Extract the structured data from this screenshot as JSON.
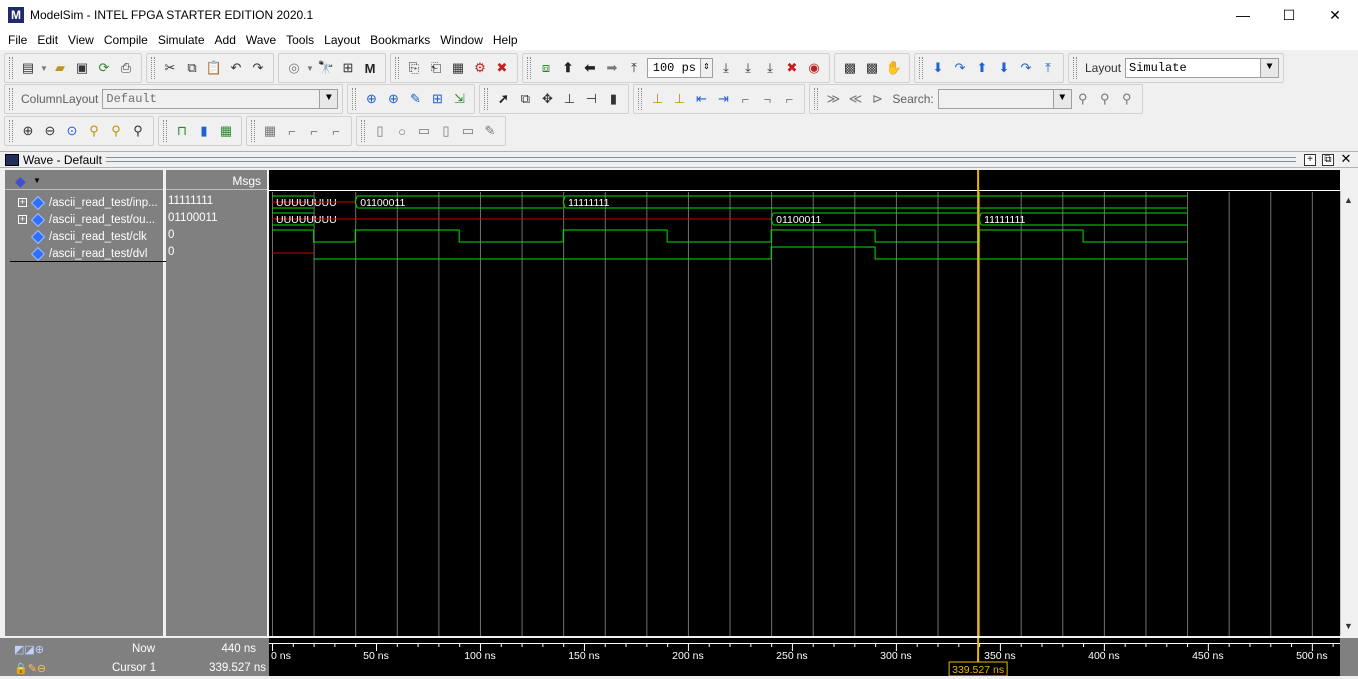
{
  "window": {
    "title": "ModelSim - INTEL FPGA STARTER EDITION 2020.1",
    "app_icon": "M",
    "controls": [
      "—",
      "☐",
      "✕"
    ]
  },
  "menu": [
    "File",
    "Edit",
    "View",
    "Compile",
    "Simulate",
    "Add",
    "Wave",
    "Tools",
    "Layout",
    "Bookmarks",
    "Window",
    "Help"
  ],
  "toolbar": {
    "run_length": "100 ps",
    "layout_label": "Layout",
    "layout_value": "Simulate",
    "column_layout_label": "ColumnLayout",
    "column_layout_value": "Default",
    "search_label": "Search:"
  },
  "wave_window": {
    "title": "Wave - Default",
    "msgs_header": "Msgs",
    "signals": [
      {
        "name": "/ascii_read_test/inp...",
        "value": "11111111",
        "expandable": true
      },
      {
        "name": "/ascii_read_test/ou...",
        "value": "01100011",
        "expandable": true
      },
      {
        "name": "/ascii_read_test/clk",
        "value": "0",
        "expandable": false
      },
      {
        "name": "/ascii_read_test/dvl",
        "value": "0",
        "expandable": false
      }
    ],
    "now_label": "Now",
    "now_value": "440 ns",
    "cursor_label": "Cursor 1",
    "cursor_value": "339.527 ns",
    "cursor_time_ns": 339.527,
    "time_axis": {
      "labels": [
        "0 ns",
        "50 ns",
        "100 ns",
        "150 ns",
        "200 ns",
        "250 ns",
        "300 ns",
        "350 ns",
        "400 ns",
        "450 ns",
        "500 ns"
      ],
      "max_ns": 510
    },
    "waves": {
      "inp": [
        {
          "t0": 0,
          "t1": 20,
          "label": "UUUUUUUU",
          "unknown": true
        },
        {
          "t0": 20,
          "t1": 40,
          "label": "",
          "unknown": true
        },
        {
          "t0": 40,
          "t1": 140,
          "label": "01100011",
          "unknown": false
        },
        {
          "t0": 140,
          "t1": 440,
          "label": "11111111",
          "unknown": false
        }
      ],
      "out": [
        {
          "t0": 0,
          "t1": 20,
          "label": "UUUUUUUU",
          "unknown": true
        },
        {
          "t0": 20,
          "t1": 240,
          "label": "",
          "unknown": true
        },
        {
          "t0": 240,
          "t1": 340,
          "label": "01100011",
          "unknown": false
        },
        {
          "t0": 340,
          "t1": 440,
          "label": "11111111",
          "unknown": false
        }
      ],
      "clk_edges": [
        0,
        20,
        40,
        90,
        140,
        190,
        240,
        290,
        340,
        390,
        440
      ],
      "clk_start": 1,
      "dvl": [
        {
          "t0": 0,
          "t1": 20,
          "level": "U"
        },
        {
          "t0": 20,
          "t1": 240,
          "level": 0
        },
        {
          "t0": 240,
          "t1": 290,
          "level": 1
        },
        {
          "t0": 290,
          "t1": 440,
          "level": 0
        }
      ]
    },
    "colors": {
      "wave_green": "#00e000",
      "unknown_red": "#d00000",
      "cursor_yellow": "#e8b800",
      "grid": "#707070"
    }
  }
}
